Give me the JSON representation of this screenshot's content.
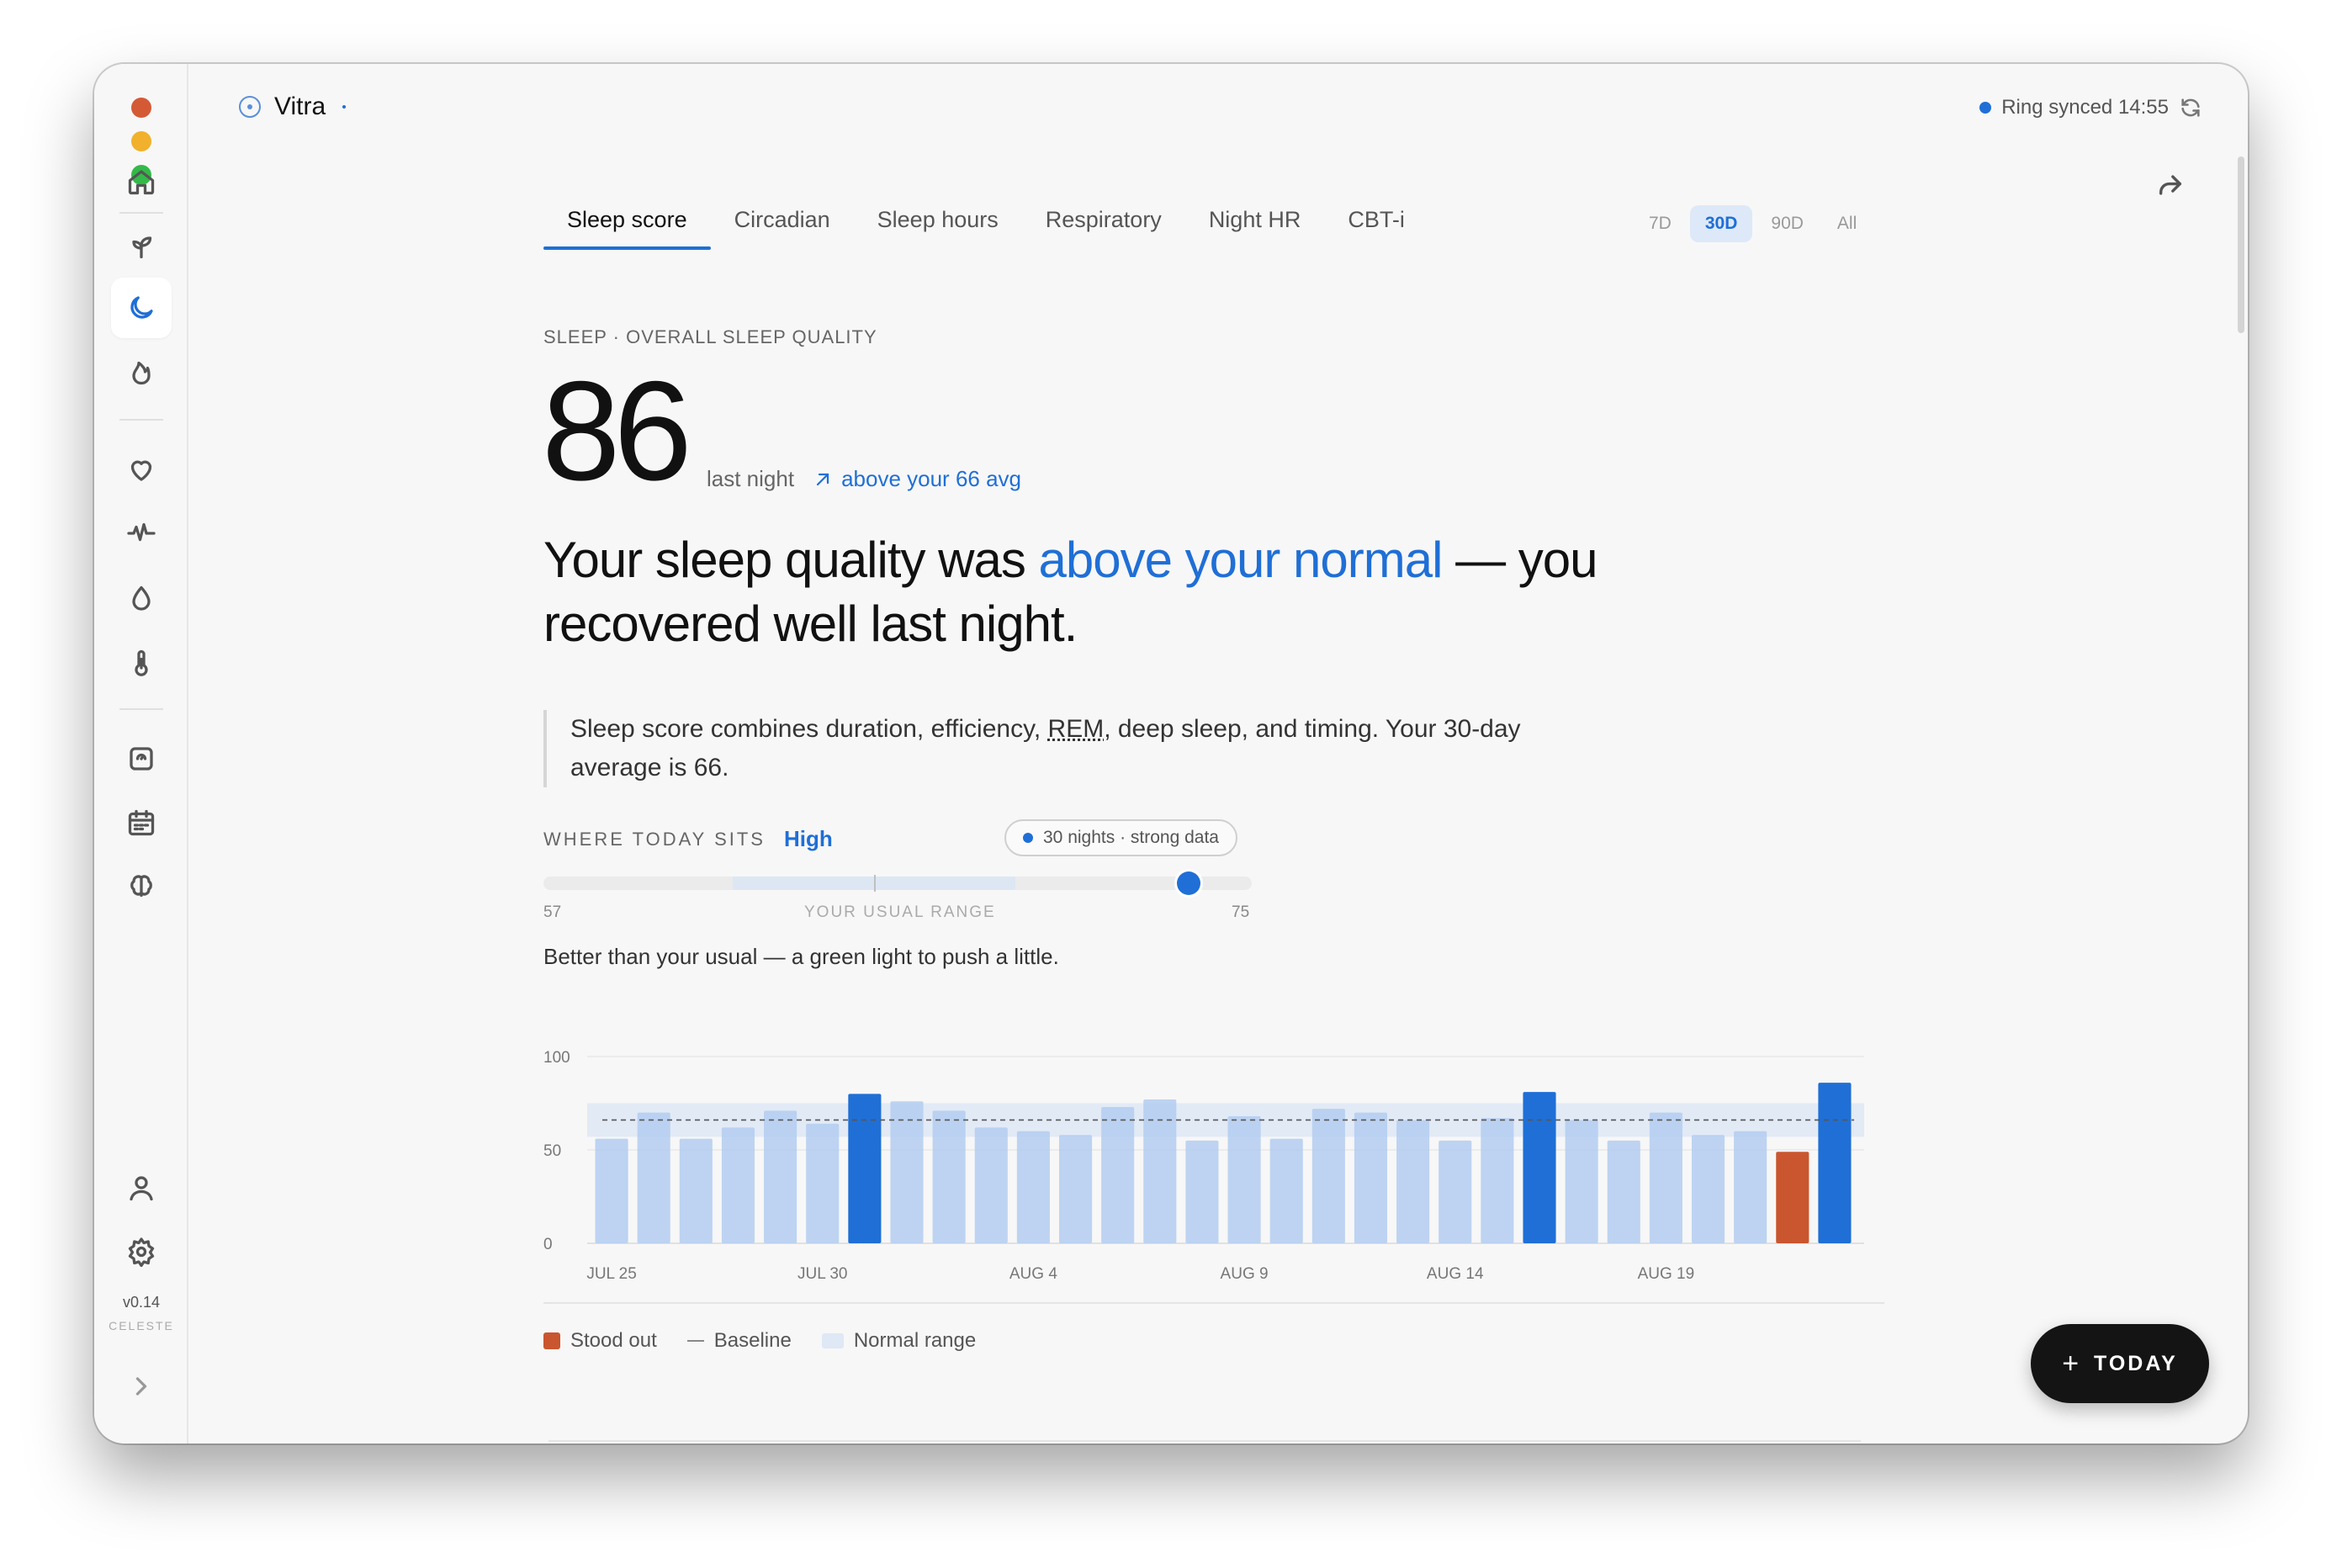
{
  "app": {
    "name": "Vitra"
  },
  "sync": {
    "text": "Ring synced 14:55"
  },
  "sidebar": {
    "icons": [
      "home-icon",
      "sprout-icon",
      "moon-icon",
      "flame-icon",
      "heart-icon",
      "pulse-icon",
      "drop-icon",
      "thermometer-icon",
      "scale-icon",
      "calendar-icon",
      "brain-icon",
      "user-icon",
      "gear-icon",
      "chevron-right-icon"
    ],
    "version": "v0.14",
    "user": "CELESTE"
  },
  "tabs": [
    "Sleep score",
    "Circadian",
    "Sleep hours",
    "Respiratory",
    "Night HR",
    "CBT-i"
  ],
  "active_tab": "Sleep score",
  "ranges": [
    "7D",
    "30D",
    "90D",
    "All"
  ],
  "active_range": "30D",
  "eyebrow": "SLEEP · OVERALL SLEEP QUALITY",
  "score": {
    "value": "86",
    "label": "last night",
    "delta": "above your 66 avg"
  },
  "headline": {
    "before": "Your sleep quality was ",
    "highlight": "above your normal",
    "after": " — you recovered well last night."
  },
  "description": {
    "before": "Sleep score combines duration, efficiency, ",
    "abbr": "REM",
    "after": ", deep sleep, and timing. Your 30-day average is 66."
  },
  "position": {
    "label": "WHERE TODAY SITS",
    "value": "High",
    "pill": "30 nights · strong data",
    "low": "57",
    "high": "75",
    "range_label": "YOUR USUAL RANGE",
    "verdict": "Better than your usual — a green light to push a little.",
    "track_min": 45,
    "track_max": 90,
    "current": 86,
    "baseline": 66
  },
  "chart_data": {
    "type": "bar",
    "ylim": [
      0,
      100
    ],
    "y_ticks": [
      0,
      50,
      100
    ],
    "x_tick_labels": [
      "JUL 25",
      "JUL 30",
      "AUG 4",
      "AUG 9",
      "AUG 14",
      "AUG 19"
    ],
    "dates": [
      "Jul 25",
      "Jul 26",
      "Jul 27",
      "Jul 28",
      "Jul 29",
      "Jul 30",
      "Jul 31",
      "Aug 1",
      "Aug 2",
      "Aug 3",
      "Aug 4",
      "Aug 5",
      "Aug 6",
      "Aug 7",
      "Aug 8",
      "Aug 9",
      "Aug 10",
      "Aug 11",
      "Aug 12",
      "Aug 13",
      "Aug 14",
      "Aug 15",
      "Aug 16",
      "Aug 17",
      "Aug 18",
      "Aug 19",
      "Aug 20",
      "Aug 21",
      "Aug 22",
      "Aug 23"
    ],
    "values": [
      56,
      70,
      56,
      62,
      71,
      64,
      80,
      76,
      71,
      62,
      60,
      58,
      73,
      77,
      55,
      68,
      56,
      72,
      70,
      66,
      55,
      67,
      81,
      66,
      55,
      70,
      58,
      60,
      49,
      86
    ],
    "categories_by_bar": [
      "normal",
      "normal",
      "normal",
      "normal",
      "normal",
      "normal",
      "high",
      "normal",
      "normal",
      "normal",
      "normal",
      "normal",
      "normal",
      "normal",
      "normal",
      "normal",
      "normal",
      "normal",
      "normal",
      "normal",
      "normal",
      "normal",
      "high",
      "normal",
      "normal",
      "normal",
      "normal",
      "normal",
      "stood-out",
      "high"
    ],
    "baseline": 66,
    "normal_range": [
      57,
      75
    ],
    "colors": {
      "normal": "#b3cdf0",
      "high": "#1f6fd6",
      "stood-out": "#c9562f",
      "band": "#dfe8f5",
      "baseline": "#555555"
    }
  },
  "legend": [
    "Stood out",
    "Baseline",
    "Normal range"
  ],
  "today_button": "TODAY"
}
